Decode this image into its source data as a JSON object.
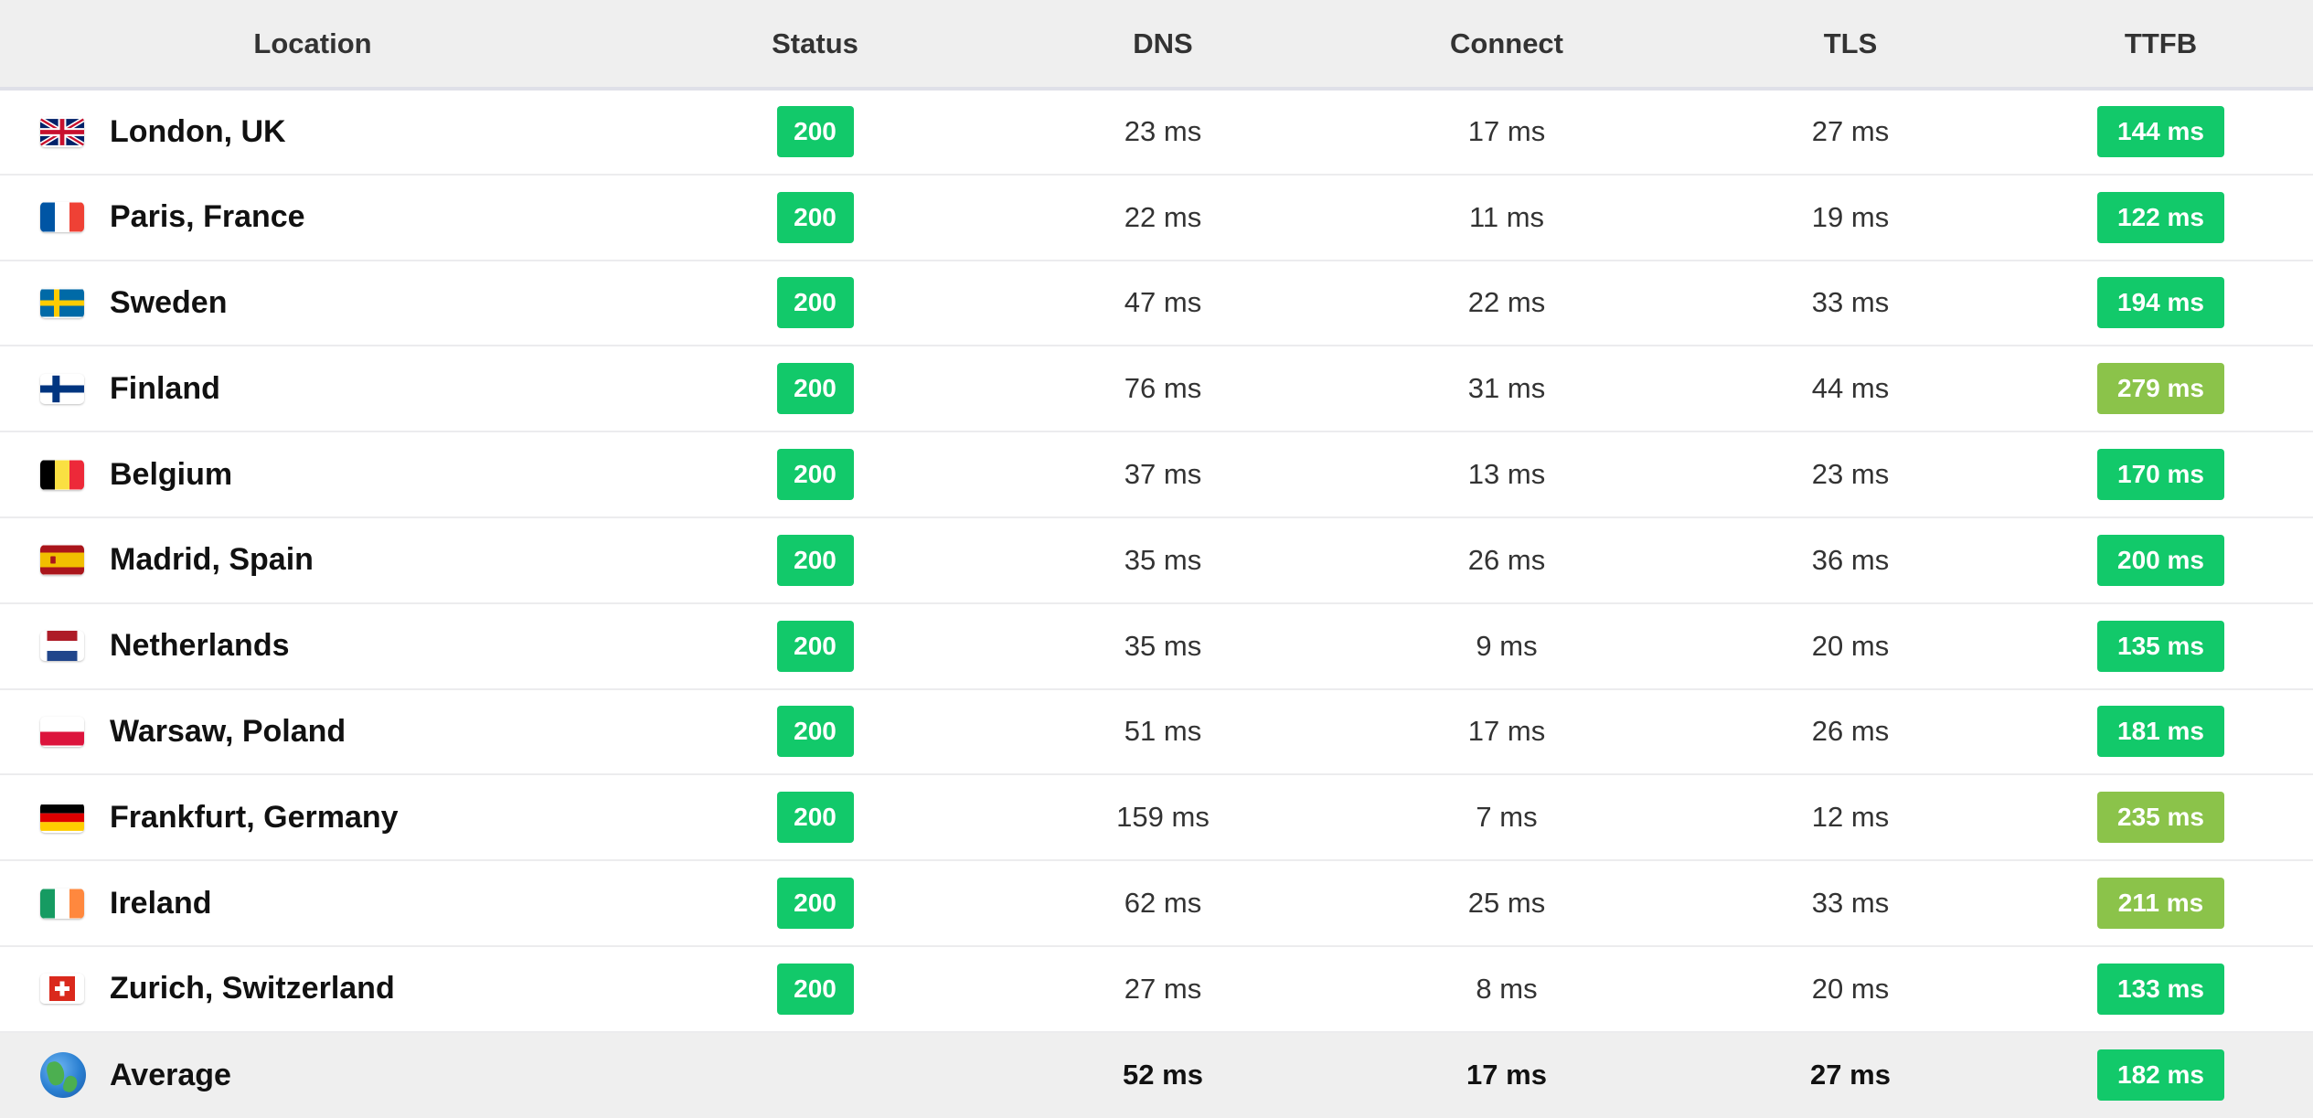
{
  "headers": {
    "location": "Location",
    "status": "Status",
    "dns": "DNS",
    "connect": "Connect",
    "tls": "TLS",
    "ttfb": "TTFB"
  },
  "colors": {
    "ttfb_fast": "#12c96a",
    "ttfb_medium": "#8bc34a",
    "status_ok": "#12c96a",
    "header_bg": "#efefef"
  },
  "rows": [
    {
      "flag": "uk-flag-icon",
      "location": "London, UK",
      "status": "200",
      "dns": "23 ms",
      "connect": "17 ms",
      "tls": "27 ms",
      "ttfb": "144 ms",
      "ttfb_color": "#12c96a"
    },
    {
      "flag": "france-flag-icon",
      "location": "Paris, France",
      "status": "200",
      "dns": "22 ms",
      "connect": "11 ms",
      "tls": "19 ms",
      "ttfb": "122 ms",
      "ttfb_color": "#12c96a"
    },
    {
      "flag": "sweden-flag-icon",
      "location": "Sweden",
      "status": "200",
      "dns": "47 ms",
      "connect": "22 ms",
      "tls": "33 ms",
      "ttfb": "194 ms",
      "ttfb_color": "#12c96a"
    },
    {
      "flag": "finland-flag-icon",
      "location": "Finland",
      "status": "200",
      "dns": "76 ms",
      "connect": "31 ms",
      "tls": "44 ms",
      "ttfb": "279 ms",
      "ttfb_color": "#8bc34a"
    },
    {
      "flag": "belgium-flag-icon",
      "location": "Belgium",
      "status": "200",
      "dns": "37 ms",
      "connect": "13 ms",
      "tls": "23 ms",
      "ttfb": "170 ms",
      "ttfb_color": "#12c96a"
    },
    {
      "flag": "spain-flag-icon",
      "location": "Madrid, Spain",
      "status": "200",
      "dns": "35 ms",
      "connect": "26 ms",
      "tls": "36 ms",
      "ttfb": "200 ms",
      "ttfb_color": "#12c96a"
    },
    {
      "flag": "netherlands-flag-icon",
      "location": "Netherlands",
      "status": "200",
      "dns": "35 ms",
      "connect": "9 ms",
      "tls": "20 ms",
      "ttfb": "135 ms",
      "ttfb_color": "#12c96a"
    },
    {
      "flag": "poland-flag-icon",
      "location": "Warsaw, Poland",
      "status": "200",
      "dns": "51 ms",
      "connect": "17 ms",
      "tls": "26 ms",
      "ttfb": "181 ms",
      "ttfb_color": "#12c96a"
    },
    {
      "flag": "germany-flag-icon",
      "location": "Frankfurt, Germany",
      "status": "200",
      "dns": "159 ms",
      "connect": "7 ms",
      "tls": "12 ms",
      "ttfb": "235 ms",
      "ttfb_color": "#8bc34a"
    },
    {
      "flag": "ireland-flag-icon",
      "location": "Ireland",
      "status": "200",
      "dns": "62 ms",
      "connect": "25 ms",
      "tls": "33 ms",
      "ttfb": "211 ms",
      "ttfb_color": "#8bc34a"
    },
    {
      "flag": "switzerland-flag-icon",
      "location": "Zurich, Switzerland",
      "status": "200",
      "dns": "27 ms",
      "connect": "8 ms",
      "tls": "20 ms",
      "ttfb": "133 ms",
      "ttfb_color": "#12c96a"
    }
  ],
  "average": {
    "icon": "globe-icon",
    "location": "Average",
    "dns": "52 ms",
    "connect": "17 ms",
    "tls": "27 ms",
    "ttfb": "182 ms",
    "ttfb_color": "#12c96a"
  }
}
